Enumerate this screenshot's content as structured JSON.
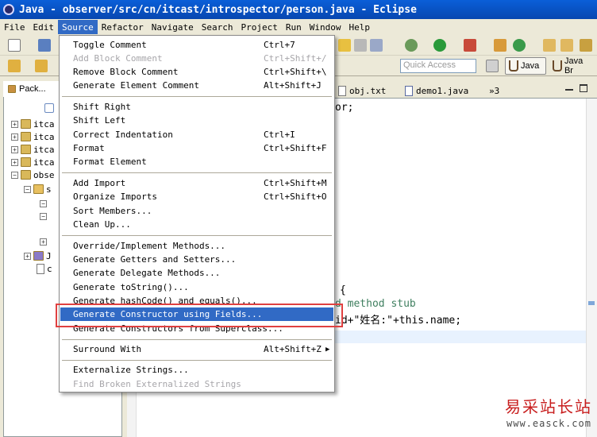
{
  "window": {
    "title": "Java - observer/src/cn/itcast/introspector/person.java - Eclipse"
  },
  "menubar": {
    "items": [
      "File",
      "Edit",
      "Source",
      "Refactor",
      "Navigate",
      "Search",
      "Project",
      "Run",
      "Window",
      "Help"
    ],
    "active": "Source"
  },
  "toolbar": {
    "quick_access_placeholder": "Quick Access",
    "perspective_java": "Java",
    "perspective_java_browsing": "Java Br"
  },
  "package_explorer": {
    "tab_label": "Pack...",
    "rows": [
      "itca",
      "itca",
      "itca",
      "itca",
      "obse",
      "s",
      "J",
      "c"
    ]
  },
  "editor": {
    "tabs": [
      "obj.txt",
      "demo1.java",
      "»3"
    ],
    "code_fragments": [
      "or;",
      "{",
      "d method stub",
      "id+\"姓名:\"+this.name;"
    ]
  },
  "source_menu": {
    "items": [
      {
        "label": "Toggle Comment",
        "accel": "Ctrl+7",
        "disabled": false
      },
      {
        "label": "Add Block Comment",
        "accel": "Ctrl+Shift+/",
        "disabled": true
      },
      {
        "label": "Remove Block Comment",
        "accel": "Ctrl+Shift+\\",
        "disabled": false
      },
      {
        "label": "Generate Element Comment",
        "accel": "Alt+Shift+J",
        "disabled": false
      },
      {
        "label": "Shift Right",
        "accel": "",
        "disabled": false
      },
      {
        "label": "Shift Left",
        "accel": "",
        "disabled": false
      },
      {
        "label": "Correct Indentation",
        "accel": "Ctrl+I",
        "disabled": false
      },
      {
        "label": "Format",
        "accel": "Ctrl+Shift+F",
        "disabled": false
      },
      {
        "label": "Format Element",
        "accel": "",
        "disabled": false
      },
      {
        "label": "Add Import",
        "accel": "Ctrl+Shift+M",
        "disabled": false
      },
      {
        "label": "Organize Imports",
        "accel": "Ctrl+Shift+O",
        "disabled": false
      },
      {
        "label": "Sort Members...",
        "accel": "",
        "disabled": false
      },
      {
        "label": "Clean Up...",
        "accel": "",
        "disabled": false
      },
      {
        "label": "Override/Implement Methods...",
        "accel": "",
        "disabled": false
      },
      {
        "label": "Generate Getters and Setters...",
        "accel": "",
        "disabled": false
      },
      {
        "label": "Generate Delegate Methods...",
        "accel": "",
        "disabled": false
      },
      {
        "label": "Generate toString()...",
        "accel": "",
        "disabled": false
      },
      {
        "label": "Generate hashCode() and equals()...",
        "accel": "",
        "disabled": false
      },
      {
        "label": "Generate Constructor using Fields...",
        "accel": "",
        "disabled": false,
        "selected": true
      },
      {
        "label": "Generate Constructors from Superclass...",
        "accel": "",
        "disabled": false
      },
      {
        "label": "Surround With",
        "accel": "Alt+Shift+Z",
        "disabled": false,
        "submenu": true
      },
      {
        "label": "Externalize Strings...",
        "accel": "",
        "disabled": false
      },
      {
        "label": "Find Broken Externalized Strings",
        "accel": "",
        "disabled": true
      }
    ]
  },
  "watermark": {
    "title": "易采站长站",
    "url": "www.easck.com"
  },
  "colors": {
    "selection": "#316ac5",
    "titlebar": "#0a5fd8",
    "annotation_box": "#e04040"
  }
}
